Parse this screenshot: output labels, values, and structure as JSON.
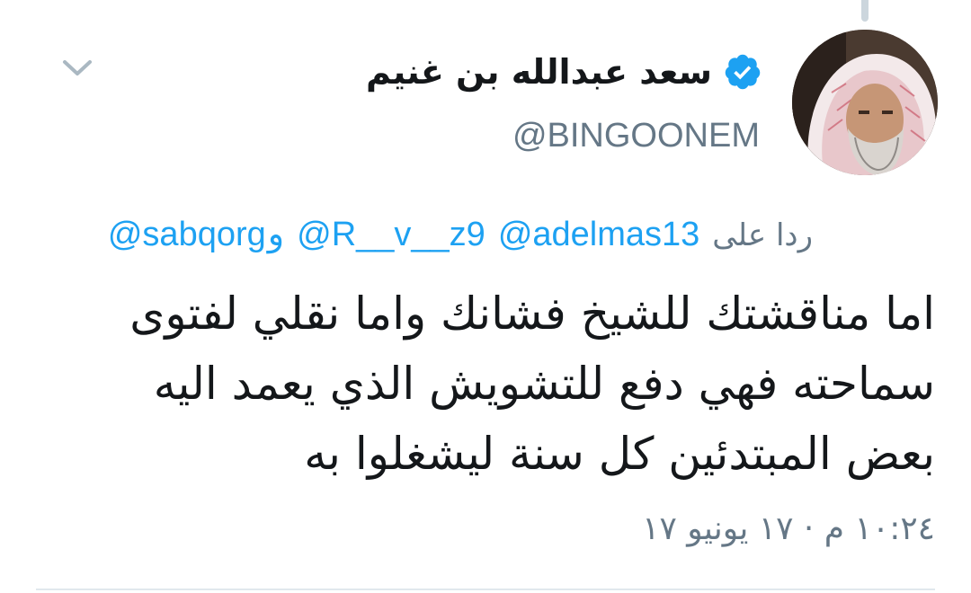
{
  "tweet": {
    "author": {
      "display_name": "سعد عبدالله بن غنيم",
      "handle": "@BINGOONEM",
      "verified": true,
      "avatar_icon": "profile-photo"
    },
    "reply_to": {
      "prefix": "ردا على",
      "mentions": [
        "@adelmas13",
        "@R__v__z9",
        "@sabqorg"
      ],
      "conjunction": "و"
    },
    "text_lines": [
      "اما مناقشتك للشيخ فشانك واما نقلي لفتوى",
      "سماحته فهي دفع للتشويش الذي يعمد اليه",
      "بعض المبتدئين كل سنة ليشغلوا به"
    ],
    "timestamp": "١٠:٢٤ م · ١٧ يونيو ١٧"
  },
  "colors": {
    "link": "#1da1f2",
    "secondary": "#657786",
    "verified": "#1da1f2",
    "thread_line": "#ccd6dd"
  },
  "icons": {
    "menu": "chevron-down-icon",
    "verified": "verified-badge-icon"
  }
}
